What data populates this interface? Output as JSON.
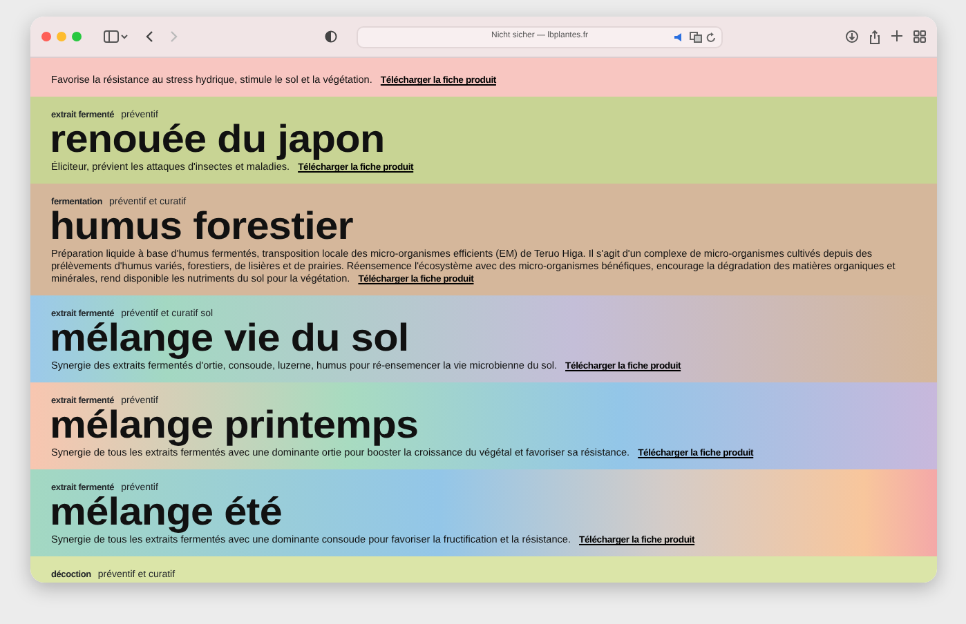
{
  "browser": {
    "address": "Nicht sicher — lbplantes.fr",
    "back_disabled": false,
    "forward_disabled": true
  },
  "products": [
    {
      "description": "Favorise la résistance au stress hydrique, stimule le sol et la végétation.",
      "link": "Télécharger la fiche produit"
    },
    {
      "method": "extrait fermenté",
      "use": "préventif",
      "title": "renouée du japon",
      "description": "Éliciteur, prévient les attaques d'insectes et maladies.",
      "link": "Télécharger la fiche produit"
    },
    {
      "method": "fermentation",
      "use": "préventif et curatif",
      "title": "humus forestier",
      "description": "Préparation liquide à base d'humus fermentés, transposition locale des micro-organismes efficients (EM) de Teruo Higa. Il s'agit d'un complexe de micro-organismes cultivés depuis des prélèvements d'humus variés, forestiers, de lisières et de prairies. Réensemence l'écosystème avec des micro-organismes bénéfiques, encourage la dégradation des matières organiques et minérales, rend disponible les nutriments du sol pour la végétation.",
      "link": "Télécharger la fiche produit"
    },
    {
      "method": "extrait fermenté",
      "use": "préventif et curatif sol",
      "title": "mélange vie du sol",
      "description": "Synergie des extraits fermentés d'ortie, consoude, luzerne, humus pour ré-ensemencer la vie microbienne du sol.",
      "link": "Télécharger la fiche produit"
    },
    {
      "method": "extrait fermenté",
      "use": "préventif",
      "title": "mélange printemps",
      "description": "Synergie de tous les extraits fermentés avec une dominante ortie pour booster la croissance du végétal et favoriser sa résistance.",
      "link": "Télécharger la fiche produit"
    },
    {
      "method": "extrait fermenté",
      "use": "préventif",
      "title": "mélange été",
      "description": "Synergie de tous les extraits fermentés avec une dominante consoude pour favoriser la fructification et la résistance.",
      "link": "Télécharger la fiche produit"
    },
    {
      "method": "décoction",
      "use": "préventif et curatif"
    }
  ]
}
